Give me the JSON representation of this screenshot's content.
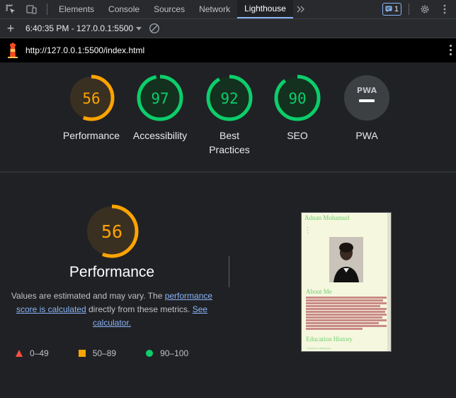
{
  "tabs": [
    {
      "label": "Elements",
      "active": false
    },
    {
      "label": "Console",
      "active": false
    },
    {
      "label": "Sources",
      "active": false
    },
    {
      "label": "Network",
      "active": false
    },
    {
      "label": "Lighthouse",
      "active": true
    }
  ],
  "issues_badge": {
    "count": "1"
  },
  "toolbar": {
    "report_selector": "6:40:35 PM - 127.0.0.1:5500"
  },
  "urlbar": {
    "url": "http://127.0.0.1:5500/index.html"
  },
  "gauges": [
    {
      "score": 56,
      "label": "Performance",
      "status": "average"
    },
    {
      "score": 97,
      "label": "Accessibility",
      "status": "pass"
    },
    {
      "score": 92,
      "label": "Best Practices",
      "label_line1": "Best",
      "label_line2": "Practices",
      "status": "pass"
    },
    {
      "score": 90,
      "label": "SEO",
      "status": "pass"
    },
    {
      "score": null,
      "label": "PWA",
      "badge_text": "PWA",
      "status": "pwa"
    }
  ],
  "detail": {
    "score": 56,
    "title": "Performance",
    "desc_part1": "Values are estimated and may vary. The ",
    "desc_link1": "performance score is calculated",
    "desc_part2": " directly from these metrics. ",
    "desc_link2": "See calculator."
  },
  "legend": [
    {
      "range": "0–49",
      "shape": "triangle",
      "color": "#ff4e42"
    },
    {
      "range": "50–89",
      "shape": "square",
      "color": "#ffa400"
    },
    {
      "range": "90–100",
      "shape": "circle",
      "color": "#0cce6b"
    }
  ],
  "thumbnail": {
    "name": "Adnan Mohamud",
    "section1": "About Me",
    "section2": "Education History",
    "bullet": "University of Washington"
  },
  "colors": {
    "average": "#ffa400",
    "average_bg": "#3a3022",
    "pass": "#0cce6b",
    "pass_bg": "#14301f",
    "pass_text": "#0cce6b",
    "average_text": "#ffa400",
    "pwa_bg": "#3c4043",
    "accent": "#8ab4f8"
  }
}
